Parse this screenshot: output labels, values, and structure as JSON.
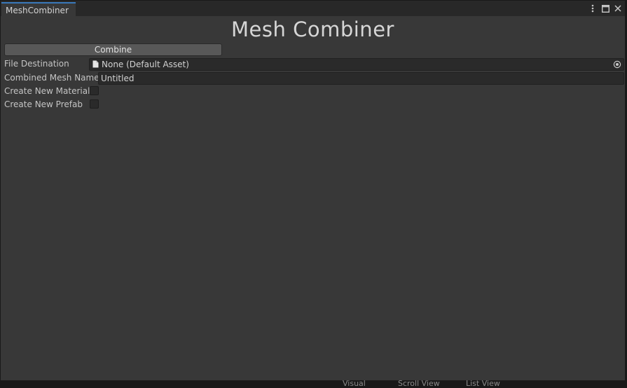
{
  "window": {
    "tab_label": "MeshCombiner",
    "controls": [
      "more-options-icon",
      "maximize-icon",
      "close-icon"
    ]
  },
  "main": {
    "title": "Mesh Combiner",
    "combine_label": "Combine",
    "fields": {
      "file_destination": {
        "label": "File Destination",
        "value": "None (Default Asset)"
      },
      "combined_mesh_name": {
        "label": "Combined Mesh Name",
        "value": "Untitled"
      },
      "create_new_material": {
        "label": "Create New Material",
        "checked": false
      },
      "create_new_prefab": {
        "label": "Create New Prefab",
        "checked": false
      }
    }
  },
  "background_peek": {
    "labels": [
      "Visual",
      "Scroll View",
      "List View"
    ]
  },
  "colors": {
    "tab_accent": "#3a79bb",
    "panel": "#383838",
    "field": "#2a2a2a",
    "button": "#585858"
  }
}
